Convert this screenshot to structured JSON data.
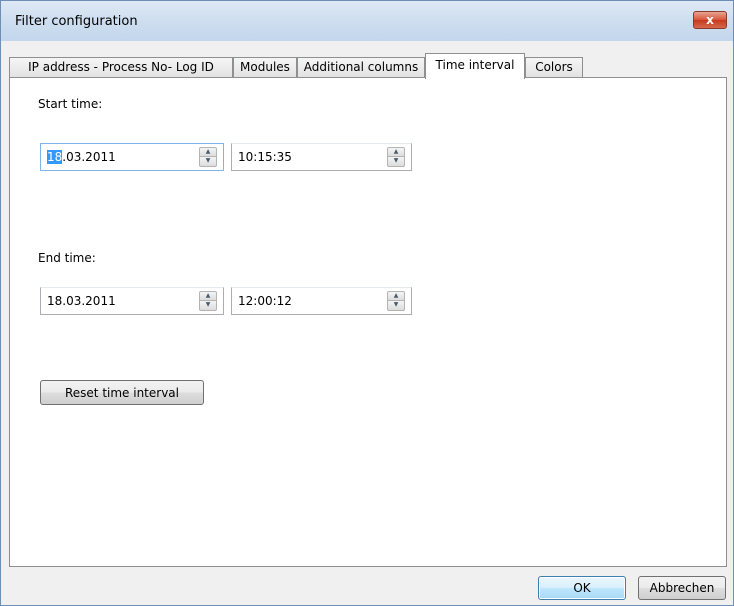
{
  "window": {
    "title": "Filter configuration",
    "close_label": "x"
  },
  "tabs": [
    {
      "label": "IP address - Process No- Log ID",
      "active": false
    },
    {
      "label": "Modules",
      "active": false
    },
    {
      "label": "Additional columns",
      "active": false
    },
    {
      "label": "Time interval",
      "active": true
    },
    {
      "label": "Colors",
      "active": false
    }
  ],
  "time_interval": {
    "start_label": "Start time:",
    "start_date_selected": "18",
    "start_date_rest": ".03.2011",
    "start_time": "10:15:35",
    "end_label": "End time:",
    "end_date": "18.03.2011",
    "end_time": "12:00:12",
    "reset_label": "Reset time interval"
  },
  "footer": {
    "ok_label": "OK",
    "cancel_label": "Abbrechen"
  },
  "icons": {
    "spin_up": "▲",
    "spin_down": "▼"
  },
  "colors": {
    "selection": "#3399ff",
    "close_button": "#c63a1f",
    "titlebar": "#cfdff0"
  }
}
